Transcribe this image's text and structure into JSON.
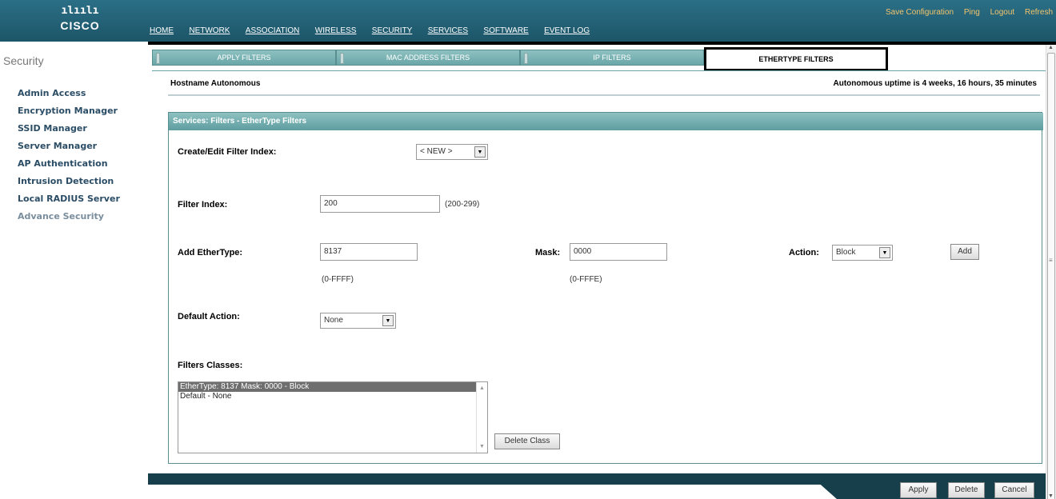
{
  "header": {
    "logo_bars": "ılıılı",
    "logo_word": "CISCO",
    "top_links": [
      "Save Configuration",
      "Ping",
      "Logout",
      "Refresh"
    ],
    "nav": [
      "HOME",
      "NETWORK",
      "ASSOCIATION",
      "WIRELESS",
      "SECURITY",
      "SERVICES",
      "SOFTWARE",
      "EVENT LOG"
    ],
    "active_nav": "SECURITY"
  },
  "sidebar": {
    "title": "Security",
    "items": [
      {
        "label": "Admin Access"
      },
      {
        "label": "Encryption Manager"
      },
      {
        "label": "SSID Manager"
      },
      {
        "label": "Server Manager"
      },
      {
        "label": "AP Authentication"
      },
      {
        "label": "Intrusion Detection"
      },
      {
        "label": "Local RADIUS Server"
      },
      {
        "label": "Advance Security"
      }
    ]
  },
  "tabs": [
    "APPLY FILTERS",
    "MAC ADDRESS FILTERS",
    "IP FILTERS",
    "ETHERTYPE FILTERS"
  ],
  "active_tab": "ETHERTYPE FILTERS",
  "host": {
    "hostname": "Hostname Autonomous",
    "uptime": "Autonomous uptime is 4 weeks, 16 hours, 35 minutes"
  },
  "panel": {
    "title": "Services: Filters - EtherType Filters",
    "create_edit_label": "Create/Edit Filter Index:",
    "create_edit_value": "< NEW >",
    "filter_index_label": "Filter Index:",
    "filter_index_value": "200",
    "filter_index_hint": "(200-299)",
    "add_ethertype_label": "Add EtherType:",
    "add_ethertype_value": "8137",
    "add_ethertype_hint": "(0-FFFF)",
    "mask_label": "Mask:",
    "mask_value": "0000",
    "mask_hint": "(0-FFFE)",
    "action_label": "Action:",
    "action_value": "Block",
    "add_button": "Add",
    "default_action_label": "Default Action:",
    "default_action_value": "None",
    "filters_classes_label": "Filters Classes:",
    "filter_classes": [
      "EtherType: 8137 Mask: 0000 - Block",
      "Default - None"
    ],
    "delete_class_button": "Delete Class"
  },
  "footer": {
    "apply": "Apply",
    "delete": "Delete",
    "cancel": "Cancel"
  },
  "colors": {
    "header_teal": "#1d5568",
    "tab_teal": "#6aa6a8",
    "link_orange": "#f2c46b",
    "sidebar_link": "#2b4d66"
  }
}
